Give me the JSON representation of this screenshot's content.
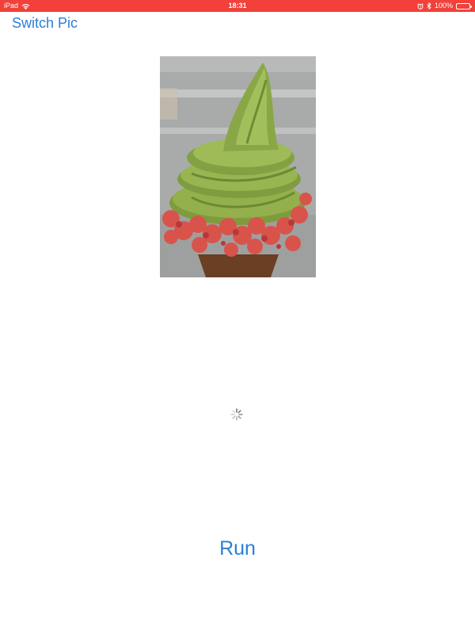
{
  "status_bar": {
    "device": "iPad",
    "time": "18:31",
    "battery_percent": "100%",
    "background_color": "#f2403a",
    "icons": [
      "wifi-icon",
      "alarm-icon",
      "bluetooth-icon",
      "battery-icon"
    ]
  },
  "nav": {
    "switch_label": "Switch Pic"
  },
  "main": {
    "image_subject": "green matcha soft-serve ice cream cone with red berry crumble",
    "loading": true
  },
  "actions": {
    "run_label": "Run"
  },
  "colors": {
    "accent": "#2a7fd6",
    "status_bar": "#f2403a"
  }
}
